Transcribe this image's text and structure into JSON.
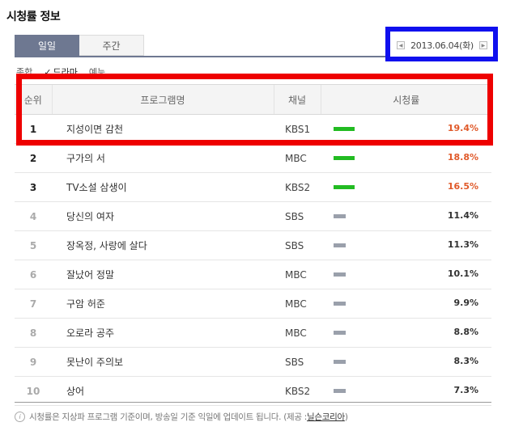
{
  "title": "시청률 정보",
  "tabs": [
    {
      "label": "일일",
      "active": true
    },
    {
      "label": "주간",
      "active": false
    }
  ],
  "date": {
    "text": "2013.06.04(화)",
    "prev_icon": "chevron-left-icon",
    "next_icon": "chevron-right-icon"
  },
  "genres": [
    {
      "label": "종합",
      "selected": false
    },
    {
      "label": "드라마",
      "selected": true
    },
    {
      "label": "예능",
      "selected": false
    }
  ],
  "table": {
    "headers": {
      "rank": "순위",
      "program": "프로그램명",
      "channel": "채널",
      "rating": "시청률"
    },
    "rows": [
      {
        "rank": "1",
        "program": "지성이면 감천",
        "channel": "KBS1",
        "rating": "19.4%"
      },
      {
        "rank": "2",
        "program": "구가의 서",
        "channel": "MBC",
        "rating": "18.8%"
      },
      {
        "rank": "3",
        "program": "TV소설 삼생이",
        "channel": "KBS2",
        "rating": "16.5%"
      },
      {
        "rank": "4",
        "program": "당신의 여자",
        "channel": "SBS",
        "rating": "11.4%"
      },
      {
        "rank": "5",
        "program": "장옥정, 사랑에 살다",
        "channel": "SBS",
        "rating": "11.3%"
      },
      {
        "rank": "6",
        "program": "잘났어 정말",
        "channel": "MBC",
        "rating": "10.1%"
      },
      {
        "rank": "7",
        "program": "구암 허준",
        "channel": "MBC",
        "rating": "9.9%"
      },
      {
        "rank": "8",
        "program": "오로라 공주",
        "channel": "MBC",
        "rating": "8.8%"
      },
      {
        "rank": "9",
        "program": "못난이 주의보",
        "channel": "SBS",
        "rating": "8.3%"
      },
      {
        "rank": "10",
        "program": "상어",
        "channel": "KBS2",
        "rating": "7.3%"
      }
    ]
  },
  "footnote": {
    "text": "시청률은 지상파 프로그램 기준이며, 방송일 기준 익일에 업데이트 됩니다. (제공 : ",
    "source": "닐슨코리아",
    "close": ")"
  },
  "colors": {
    "tab_active": "#6e7891",
    "highlight_red": "#ee0000",
    "highlight_blue": "#1010ee",
    "bar_top": "#22bb22",
    "bar_other": "#9aa0ab",
    "rating_top": "#e05a2a"
  }
}
